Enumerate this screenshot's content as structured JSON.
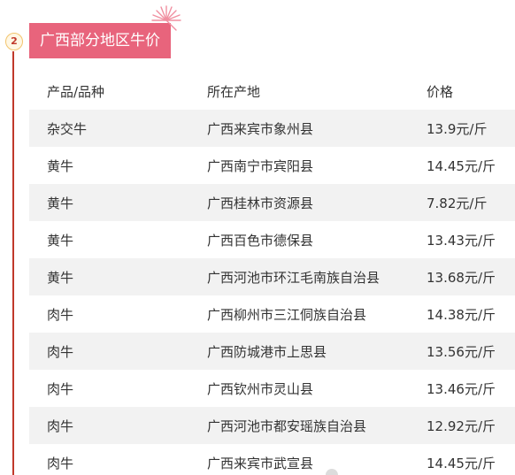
{
  "section": {
    "step_number": "2",
    "title": "广西部分地区牛价"
  },
  "table": {
    "headers": {
      "product": "产品/品种",
      "origin": "所在产地",
      "price": "价格"
    },
    "rows": [
      {
        "product": "杂交牛",
        "origin": "广西来宾市象州县",
        "price": "13.9元/斤"
      },
      {
        "product": "黄牛",
        "origin": "广西南宁市宾阳县",
        "price": "14.45元/斤"
      },
      {
        "product": "黄牛",
        "origin": "广西桂林市资源县",
        "price": "7.82元/斤"
      },
      {
        "product": "黄牛",
        "origin": "广西百色市德保县",
        "price": "13.43元/斤"
      },
      {
        "product": "黄牛",
        "origin": "广西河池市环江毛南族自治县",
        "price": "13.68元/斤"
      },
      {
        "product": "肉牛",
        "origin": "广西柳州市三江侗族自治县",
        "price": "14.38元/斤"
      },
      {
        "product": "肉牛",
        "origin": "广西防城港市上思县",
        "price": "13.56元/斤"
      },
      {
        "product": "肉牛",
        "origin": "广西钦州市灵山县",
        "price": "13.46元/斤"
      },
      {
        "product": "肉牛",
        "origin": "广西河池市都安瑶族自治县",
        "price": "12.92元/斤"
      },
      {
        "product": "肉牛",
        "origin": "广西来宾市武宣县",
        "price": "14.45元/斤"
      }
    ]
  },
  "colors": {
    "header_bg": "#e8647c",
    "accent_line": "#c0392b",
    "row_stripe": "#f2f2f2"
  },
  "icons": {
    "decoration": "firework-icon",
    "watermark": "watermark-logo-icon"
  }
}
